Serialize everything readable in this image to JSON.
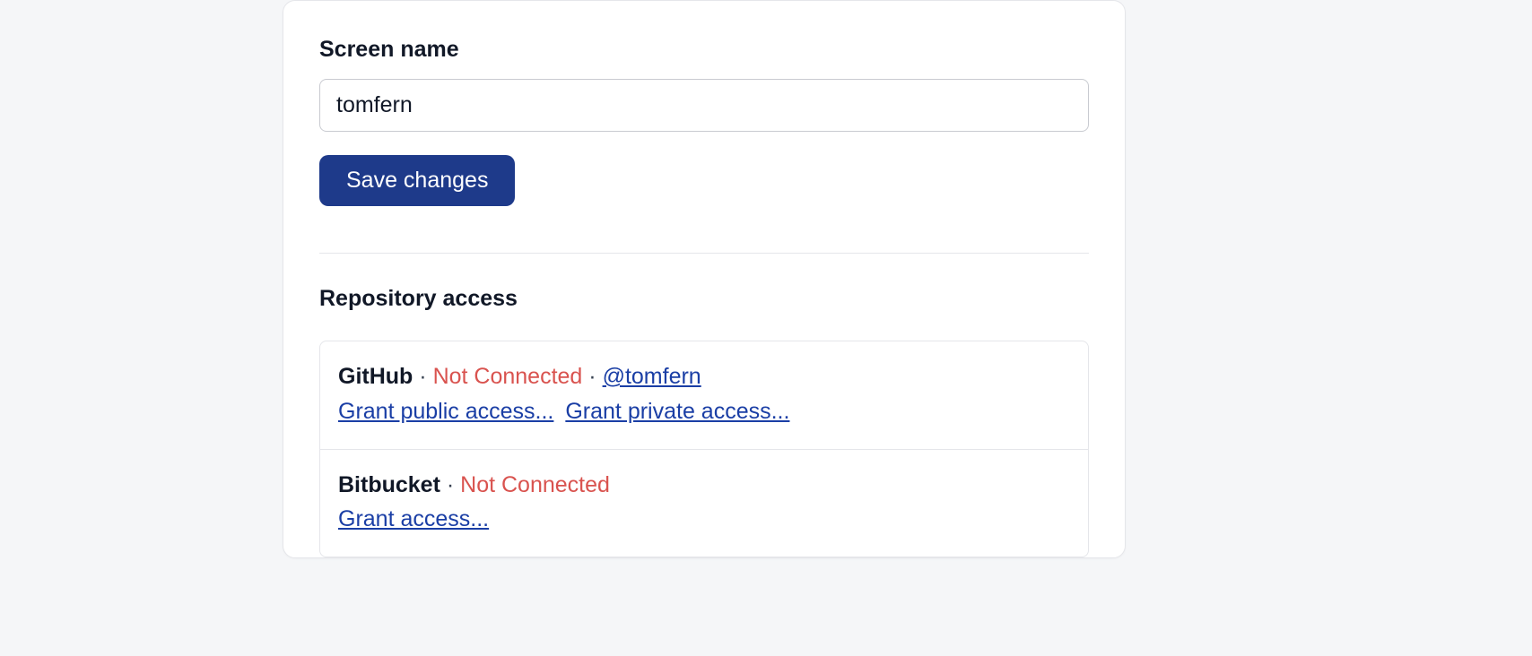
{
  "screenName": {
    "label": "Screen name",
    "value": "tomfern",
    "saveLabel": "Save changes"
  },
  "repoAccess": {
    "heading": "Repository access",
    "providers": [
      {
        "name": "GitHub",
        "status": "Not Connected",
        "handle": "@tomfern",
        "links": [
          {
            "label": "Grant public access..."
          },
          {
            "label": "Grant private access..."
          }
        ]
      },
      {
        "name": "Bitbucket",
        "status": "Not Connected",
        "handle": "",
        "links": [
          {
            "label": "Grant access..."
          }
        ]
      }
    ]
  }
}
